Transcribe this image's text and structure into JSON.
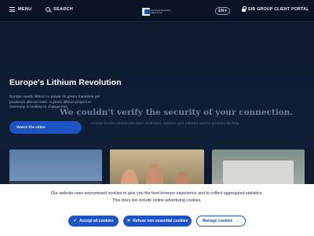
{
  "header": {
    "menu_label": "MENU",
    "search_label": "SEARCH",
    "logo_text": "European Investment Bank Group",
    "language": "EN",
    "portal_label": "EIB GROUP CLIENT PORTAL"
  },
  "hero": {
    "title": "Europe's Lithium Revolution",
    "description": "Europe needs lithium to power its green transition yet produces almost none. A green lithium project in Germany is looking to change this.",
    "watch_button": "Watch the video"
  },
  "error_overlay": {
    "title": "We couldn't verify the security of your connection.",
    "subtitle": "Access to this content has been restricted. Contact your internet service provider for help."
  },
  "cookie_banner": {
    "text": "Our website uses anonymised cookies to give you the best browser experience and to collect aggregated statistics. This does not include online advertising cookies.",
    "accept_label": "Accept all cookies",
    "refuse_label": "Refuse non essential cookies",
    "manage_label": "Manage cookies"
  },
  "colors": {
    "accent": "#1d53c4",
    "header_bg": "#0a1426",
    "hero_bg": "#0e1b30"
  }
}
